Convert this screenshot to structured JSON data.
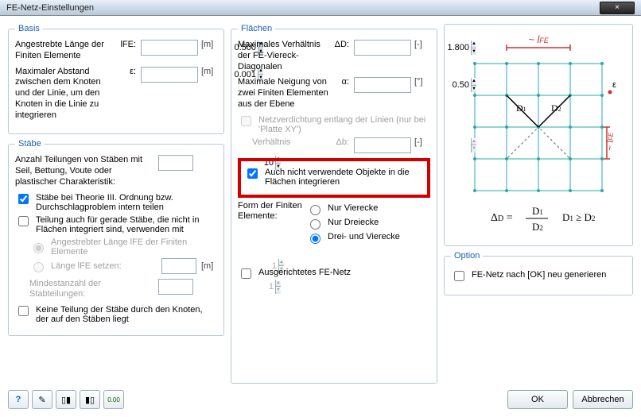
{
  "title": "FE-Netz-Einstellungen",
  "close": "×",
  "basis": {
    "legend": "Basis",
    "lFE_label": "Angestrebte Länge der Finiten Elemente",
    "lFE_sym": "lFE:",
    "lFE_val": "0.500",
    "lFE_unit": "[m]",
    "eps_label": "Maximaler Abstand zwischen dem Knoten und der Linie, um den Knoten in die Linie zu integrieren",
    "eps_sym": "ε:",
    "eps_val": "0.001",
    "eps_unit": "[m]"
  },
  "staebe": {
    "legend": "Stäbe",
    "teilungen_label": "Anzahl Teilungen von Stäben mit Seil, Bettung, Voute oder plastischer Charakteristik:",
    "teilungen_val": "10",
    "theorieIII": "Stäbe bei Theorie III. Ordnung bzw. Durchschlagproblem intern teilen",
    "geradeStaebe": "Teilung auch für gerade Stäbe, die nicht in Flächen integriert sind, verwenden mit",
    "opt_angestrebt": "Angestrebter Länge lFE der Finiten Elemente",
    "opt_lfe_setzen": "Länge lFE setzen:",
    "opt_lfe_val": "1",
    "opt_lfe_unit": "[m]",
    "min_label": "Mindestanzahl der Stabteilungen:",
    "min_val": "1",
    "keine_teilung": "Keine Teilung der Stäbe durch den Knoten, der auf den Stäben liegt"
  },
  "flaechen": {
    "legend": "Flächen",
    "diag_label": "Maximales Verhältnis der FE-Viereck-Diagonalen",
    "diag_sym": "ΔD:",
    "diag_val": "1.800",
    "diag_unit": "[-]",
    "neig_label": "Maximale Neigung von zwei Finiten Elementen aus der Ebene",
    "neig_sym": "α:",
    "neig_val": "0.50",
    "neig_unit": "[°]",
    "netzverdichtung": "Netzverdichtung entlang der Linien (nur bei 'Platte XY')",
    "verh_label": "Verhältnis",
    "verh_sym": "Δb:",
    "verh_unit": "[-]",
    "auch_objekte": "Auch nicht verwendete Objekte in die Flächen integrieren",
    "form_label": "Form der Finiten Elemente:",
    "form_vierecke": "Nur Vierecke",
    "form_dreiecke": "Nur Dreiecke",
    "form_beide": "Drei- und Vierecke",
    "ausgerichtet": "Ausgerichtetes FE-Netz"
  },
  "option": {
    "legend": "Option",
    "regen": "FE-Netz nach [OK] neu generieren"
  },
  "diagram": {
    "lfe_tilde": "~ lFE",
    "d1": "D1",
    "d2": "D2",
    "eps": "ε",
    "formula_left": "ΔD = D1 / D2",
    "formula_right": "D1 ≥ D2"
  },
  "footer": {
    "ok": "OK",
    "cancel": "Abbrechen"
  },
  "icons": {
    "help": "?",
    "edit": "✎",
    "col1": "▮▯",
    "col2": "▯▮",
    "num": "0.00"
  }
}
